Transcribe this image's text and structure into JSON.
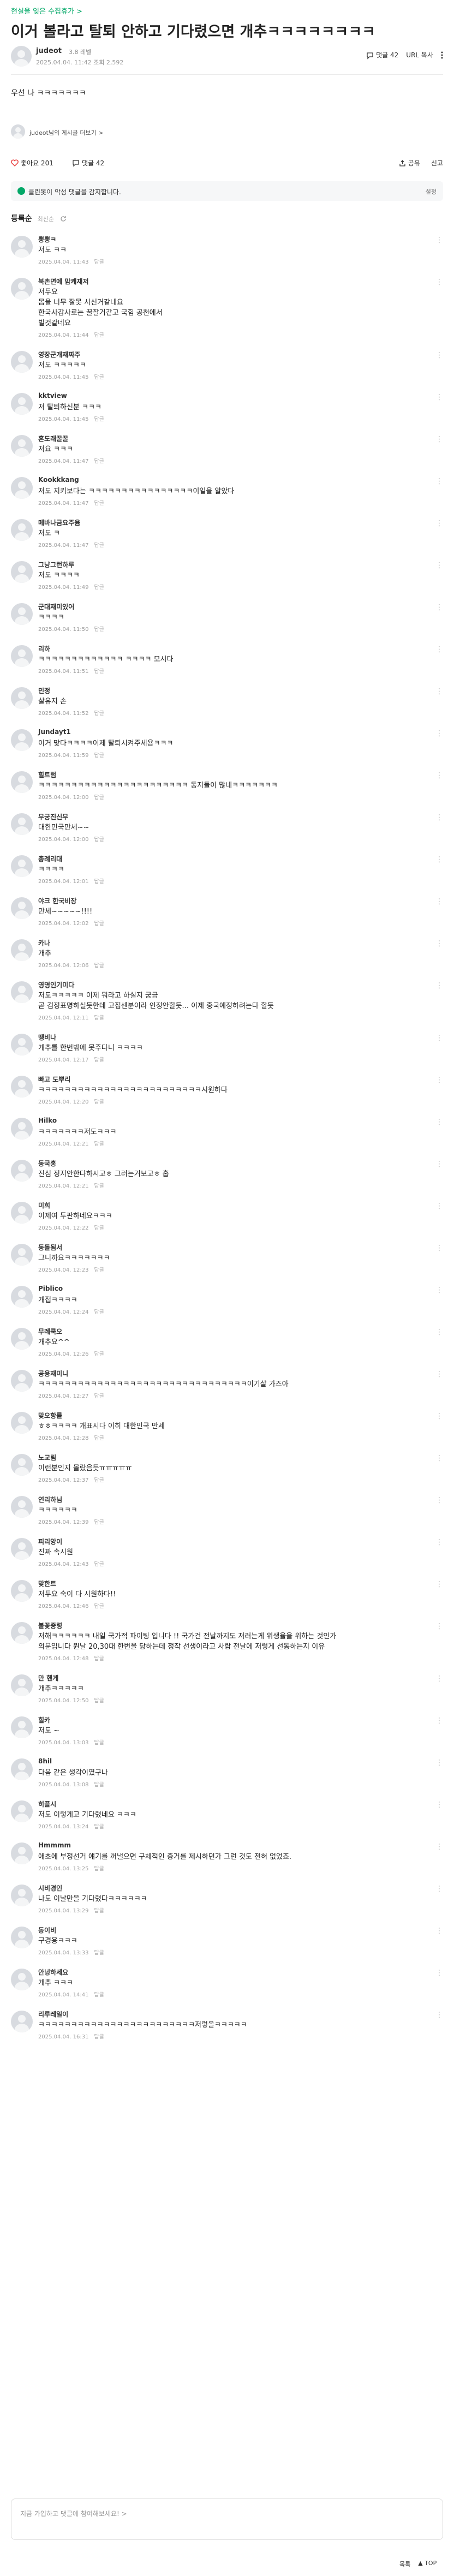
{
  "breadcrumb": "현실을 잊은 수집휴가 >",
  "title": "이거 볼라고 탈퇴 안하고 기다렸으면 개추ㅋㅋㅋㅋㅋㅋㅋㅋ",
  "author": {
    "name": "judeot",
    "level": "3.8 레벨",
    "meta": "2025.04.04. 11:42  조회 2,592"
  },
  "header_actions": {
    "comment": "댓글 42",
    "url": "URL 복사"
  },
  "post_body": "우선 나 ㅋㅋㅋㅋㅋㅋㅋ",
  "profile_link": "judeot님의 게시글 더보기 >",
  "reaction": {
    "like": "좋아요 201",
    "comment": "댓글 42",
    "share": "공유",
    "report": "신고"
  },
  "clean_bar": {
    "text": "클린봇이 악성 댓글을 감지합니다.",
    "settings": "설정"
  },
  "comment_header": {
    "title": "등록순",
    "option": "최신순"
  },
  "colors": {
    "brand": "#03a868",
    "like": "#e94140"
  },
  "icons": [
    "comment-icon",
    "link-icon",
    "more-icon",
    "heart-icon",
    "share-icon",
    "clean-icon",
    "refresh-icon",
    "kebab-icon"
  ],
  "comments": [
    {
      "name": "뽕뽕ㅋ",
      "text": "저도 ㅋㅋ",
      "meta": "2025.04.04. 11:43",
      "reply": "답글"
    },
    {
      "name": "북촌면에 맘케재저",
      "text": "저두요\n몸을 너무 잘못 서신거같네요\n한국사감사로는 꿀잘거같고 국힘 공천에서\n빌것같네요",
      "meta": "2025.04.04. 11:44",
      "reply": "답글"
    },
    {
      "name": "영장군개재짜주",
      "text": "저도 ㅋㅋㅋㅋㅋ",
      "meta": "2025.04.04. 11:45",
      "reply": "답글"
    },
    {
      "name": "kktview",
      "text": "저 탈퇴하신분 ㅋㅋㅋ",
      "meta": "2025.04.04. 11:45",
      "reply": "답글"
    },
    {
      "name": "혼도래꿀꿀",
      "text": "저요 ㅋㅋㅋ",
      "meta": "2025.04.04. 11:47",
      "reply": "답글"
    },
    {
      "name": "Kookkkang",
      "text": "저도 지키보다는 ㅋㅋㅋㅋㅋㅋㅋㅋㅋㅋㅋㅋㅋㅋㅋㅋ이일을 알았다",
      "meta": "2025.04.04. 11:47",
      "reply": "답글"
    },
    {
      "name": "메바나금요주윰",
      "text": "저도 ㅋ",
      "meta": "2025.04.04. 11:47",
      "reply": "답글"
    },
    {
      "name": "그냥그런하루",
      "text": "저도 ㅋㅋㅋㅋ",
      "meta": "2025.04.04. 11:49",
      "reply": "답글"
    },
    {
      "name": "군대재미있어",
      "text": "ㅋㅋㅋㅋ",
      "meta": "2025.04.04. 11:50",
      "reply": "답글"
    },
    {
      "name": "리하",
      "text": "ㅋㅋㅋㅋㅋㅋㅋㅋㅋㅋㅋㅋㅋ ㅋㅋㅋㅋ 모시다",
      "meta": "2025.04.04. 11:51",
      "reply": "답글"
    },
    {
      "name": "민정",
      "text": "살유지 손",
      "meta": "2025.04.04. 11:52",
      "reply": "답글"
    },
    {
      "name": "Jundayt1",
      "text": "이거 맞다ㅋㅋㅋㅋ이제 탈퇴시켜주세용ㅋㅋㅋ",
      "meta": "2025.04.04. 11:59",
      "reply": "답글"
    },
    {
      "name": "힐트럼",
      "text": "ㅋㅋㅋㅋㅋㅋㅋㅋㅋㅋㅋㅋㅋㅋㅋㅋㅋㅋㅋㅋㅋㅋㅋ 동지들이 많네ㅋㅋㅋㅋㅋㅋㅋ",
      "meta": "2025.04.04. 12:00",
      "reply": "답글"
    },
    {
      "name": "무궁진신무",
      "text": "대한민국만세~~",
      "meta": "2025.04.04. 12:00",
      "reply": "답글"
    },
    {
      "name": "총례리대",
      "text": "ㅋㅋㅋㅋ",
      "meta": "2025.04.04. 12:01",
      "reply": "답글"
    },
    {
      "name": "야크 한국비장",
      "text": "만세~~~~~!!!!",
      "meta": "2025.04.04. 12:02",
      "reply": "답글"
    },
    {
      "name": "카나",
      "text": "개추",
      "meta": "2025.04.04. 12:06",
      "reply": "답글"
    },
    {
      "name": "영명인기미다",
      "text": "저도ㅋㅋㅋㅋㅋ 이제 뭐라고 하실지 궁금\n곧 검정표명하실듯한데 고집센분이라 인정안할듯... 이제 중국예정하려는다 할듯",
      "meta": "2025.04.04. 12:11",
      "reply": "답글"
    },
    {
      "name": "땡비나",
      "text": "개추를 한번밖에 못주다니 ㅋㅋㅋㅋ",
      "meta": "2025.04.04. 12:17",
      "reply": "답글"
    },
    {
      "name": "빠고 도뿌리",
      "text": "ㅋㅋㅋㅋㅋㅋㅋㅋㅋㅋㅋㅋㅋㅋㅋㅋㅋㅋㅋㅋㅋㅋㅋㅋㅋ시원하다",
      "meta": "2025.04.04. 12:20",
      "reply": "답글"
    },
    {
      "name": "Hilko",
      "text": "ㅋㅋㅋㅋㅋㅋㅋ저도ㅋㅋㅋ",
      "meta": "2025.04.04. 12:21",
      "reply": "답글"
    },
    {
      "name": "동국홍",
      "text": "진심 정지안한다하시고ㅎ 그러는거보고ㅎ 홉",
      "meta": "2025.04.04. 12:21",
      "reply": "답글"
    },
    {
      "name": "미희",
      "text": "이제여 투판하네요ㅋㅋㅋ",
      "meta": "2025.04.04. 12:22",
      "reply": "답글"
    },
    {
      "name": "동돌됨서",
      "text": "그니까요ㅋㅋㅋㅋㅋㅋㅋ",
      "meta": "2025.04.04. 12:23",
      "reply": "답글"
    },
    {
      "name": "Piblico",
      "text": "개접ㅋㅋㅋㅋ",
      "meta": "2025.04.04. 12:24",
      "reply": "답글"
    },
    {
      "name": "무례쿡오",
      "text": "개추요^^",
      "meta": "2025.04.04. 12:26",
      "reply": "답글"
    },
    {
      "name": "공용재미니",
      "text": "ㅋㅋㅋㅋㅋㅋㅋㅋㅋㅋㅋㅋㅋㅋㅋㅋㅋㅋㅋㅋㅋㅋㅋㅋㅋㅋㅋㅋㅋㅋㅋㅋ이기살 가즈아",
      "meta": "2025.04.04. 12:27",
      "reply": "답글"
    },
    {
      "name": "맞오항률",
      "text": "ㅎㅎㅋㅋㅋㅋ 개표시다 이히 대한민국 만세",
      "meta": "2025.04.04. 12:28",
      "reply": "답글"
    },
    {
      "name": "노교림",
      "text": "이런분인지 몰랐음듯ㅠㅠㅠㅠㅠ",
      "meta": "2025.04.04. 12:37",
      "reply": "답글"
    },
    {
      "name": "연리하님",
      "text": "ㅋㅋㅋㅋㅋㅋ",
      "meta": "2025.04.04. 12:39",
      "reply": "답글"
    },
    {
      "name": "피리앙이",
      "text": "진짜 속시원",
      "meta": "2025.04.04. 12:43",
      "reply": "답글"
    },
    {
      "name": "맞한트",
      "text": "저두요 숙이 다 시원하다!!",
      "meta": "2025.04.04. 12:46",
      "reply": "답글"
    },
    {
      "name": "불꽃중령",
      "text": "저해ㅋㅋㅋㅋㅋㅋ 내일 국가적 파이팅 입니다 !! 국가건 전날까지도 저러는게 위생율을 위하는 것인가\n의문입니다 뭔날 20,30대 한번을 당하는데 정작 선생이라고 사람 전날에 저렇게 선동하는지 이유",
      "meta": "2025.04.04. 12:48",
      "reply": "답글"
    },
    {
      "name": "만 핸게",
      "text": "개추ㅋㅋㅋㅋㅋ",
      "meta": "2025.04.04. 12:50",
      "reply": "답글"
    },
    {
      "name": "힐카",
      "text": "저도 ~",
      "meta": "2025.04.04. 13:03",
      "reply": "답글"
    },
    {
      "name": "8hil",
      "text": "다음 같은 생각이였구나",
      "meta": "2025.04.04. 13:08",
      "reply": "답글"
    },
    {
      "name": "히플시",
      "text": "저도 이렇게고 기다렸네요 ㅋㅋㅋ",
      "meta": "2025.04.04. 13:24",
      "reply": "답글"
    },
    {
      "name": "Hmmmm",
      "text": "애초에 부정선거 얘기를 꺼낼으면 구체적인 증거를 제시하던가 그런 것도 전혀 없었죠.",
      "meta": "2025.04.04. 13:25",
      "reply": "답글"
    },
    {
      "name": "시비경인",
      "text": "나도 이날만을 기다렸다ㅋㅋㅋㅋㅋㅋ",
      "meta": "2025.04.04. 13:29",
      "reply": "답글"
    },
    {
      "name": "동이비",
      "text": "구경용ㅋㅋㅋ",
      "meta": "2025.04.04. 13:33",
      "reply": "답글"
    },
    {
      "name": "안녕하세요",
      "text": "개추 ㅋㅋㅋ",
      "meta": "2025.04.04. 14:41",
      "reply": "답글"
    },
    {
      "name": "리루레일이",
      "text": "ㅋㅋㅋㅋㅋㅋㅋㅋㅋㅋㅋㅋㅋㅋㅋㅋㅋㅋㅋㅋㅋㅋㅋㅋ저렇을ㅋㅋㅋㅋㅋ",
      "meta": "2025.04.04. 16:31",
      "reply": "답글"
    }
  ],
  "comment_input": {
    "placeholder": "지금 가입하고 댓글에 참여해보세요! >"
  },
  "bottom_links": {
    "list": "목록",
    "top": "▲ TOP"
  }
}
